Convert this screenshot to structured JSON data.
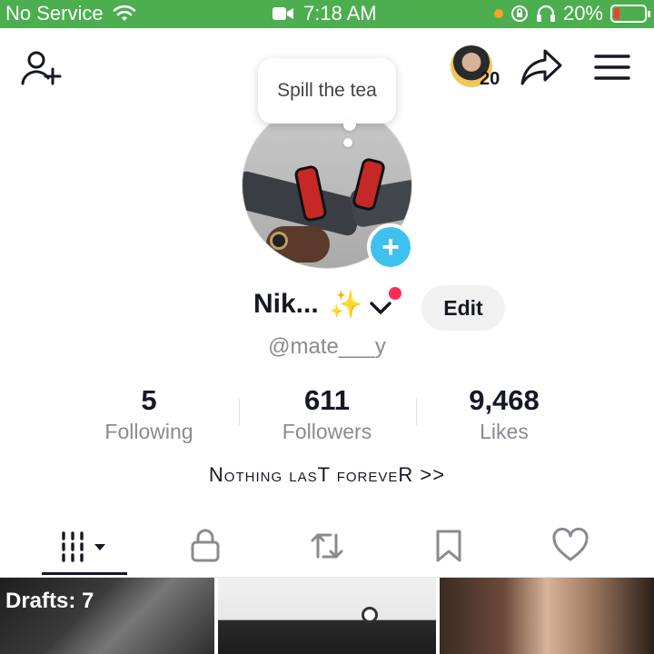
{
  "status_bar": {
    "carrier": "No Service",
    "time": "7:18 AM",
    "battery_percent": "20%",
    "battery_level": 0.2,
    "background_color": "#4cae4f",
    "icons": [
      "wifi-icon",
      "video-camera-icon",
      "orientation-lock-icon",
      "headphones-icon",
      "battery-icon"
    ]
  },
  "top_bar": {
    "add_friend_icon": "add-friend-icon",
    "story_count": "20",
    "share_icon": "share-arrow-icon",
    "menu_icon": "hamburger-menu-icon"
  },
  "tooltip": {
    "text": "Spill the tea"
  },
  "profile": {
    "name": "Nik...",
    "emoji": "✨",
    "username": "@mate___y",
    "edit_label": "Edit",
    "bio": "Nothing lasT foreveR >>"
  },
  "stats": {
    "following": {
      "value": "5",
      "label": "Following"
    },
    "followers": {
      "value": "611",
      "label": "Followers"
    },
    "likes": {
      "value": "9,468",
      "label": "Likes"
    }
  },
  "tabs": [
    {
      "name": "videos",
      "icon": "grid-icon",
      "active": true
    },
    {
      "name": "private",
      "icon": "lock-icon"
    },
    {
      "name": "reposts",
      "icon": "repost-icon"
    },
    {
      "name": "favorites",
      "icon": "bookmark-icon"
    },
    {
      "name": "liked",
      "icon": "heart-icon"
    }
  ],
  "grid": {
    "drafts_label": "Drafts: 7"
  },
  "colors": {
    "accent_blue": "#3ec1ef",
    "notification_red": "#fe2c55",
    "text_primary": "#161823",
    "text_secondary": "#8a8b91"
  }
}
